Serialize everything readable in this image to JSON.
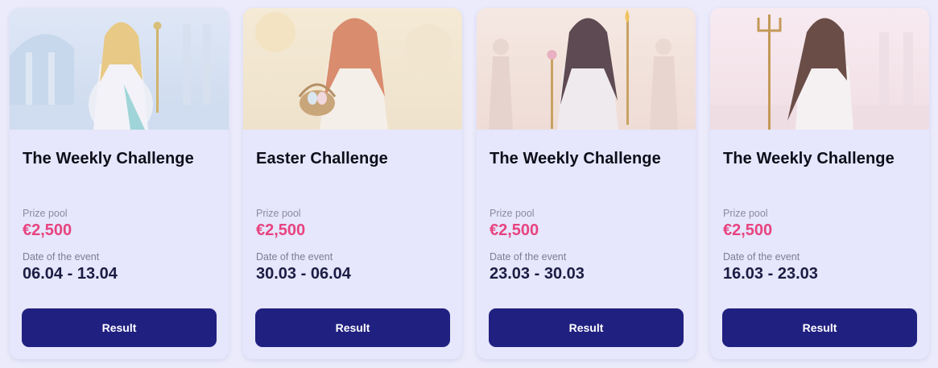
{
  "colors": {
    "page_bg": "#ebebfb",
    "card_bg": "#e6e6fc",
    "title": "#0e0e1a",
    "label": "#8a8aa3",
    "prize": "#e8437f",
    "date": "#1c1c44",
    "button_bg": "#202080",
    "button_text": "#ffffff"
  },
  "cards": [
    {
      "title": "The Weekly Challenge",
      "prize_label": "Prize pool",
      "prize_value": "€2,500",
      "date_label": "Date of the event",
      "date_value": "06.04 - 13.04",
      "button_label": "Result",
      "banner": "goddess-with-caduceus-temple-image"
    },
    {
      "title": "Easter Challenge",
      "prize_label": "Prize pool",
      "prize_value": "€2,500",
      "date_label": "Date of the event",
      "date_value": "30.03 - 06.04",
      "button_label": "Result",
      "banner": "goddess-with-easter-basket-image"
    },
    {
      "title": "The Weekly Challenge",
      "prize_label": "Prize pool",
      "prize_value": "€2,500",
      "date_label": "Date of the event",
      "date_value": "23.03 - 30.03",
      "button_label": "Result",
      "banner": "goddess-with-torch-and-staff-image"
    },
    {
      "title": "The Weekly Challenge",
      "prize_label": "Prize pool",
      "prize_value": "€2,500",
      "date_label": "Date of the event",
      "date_value": "16.03 - 23.03",
      "button_label": "Result",
      "banner": "goddess-with-trident-image"
    }
  ]
}
